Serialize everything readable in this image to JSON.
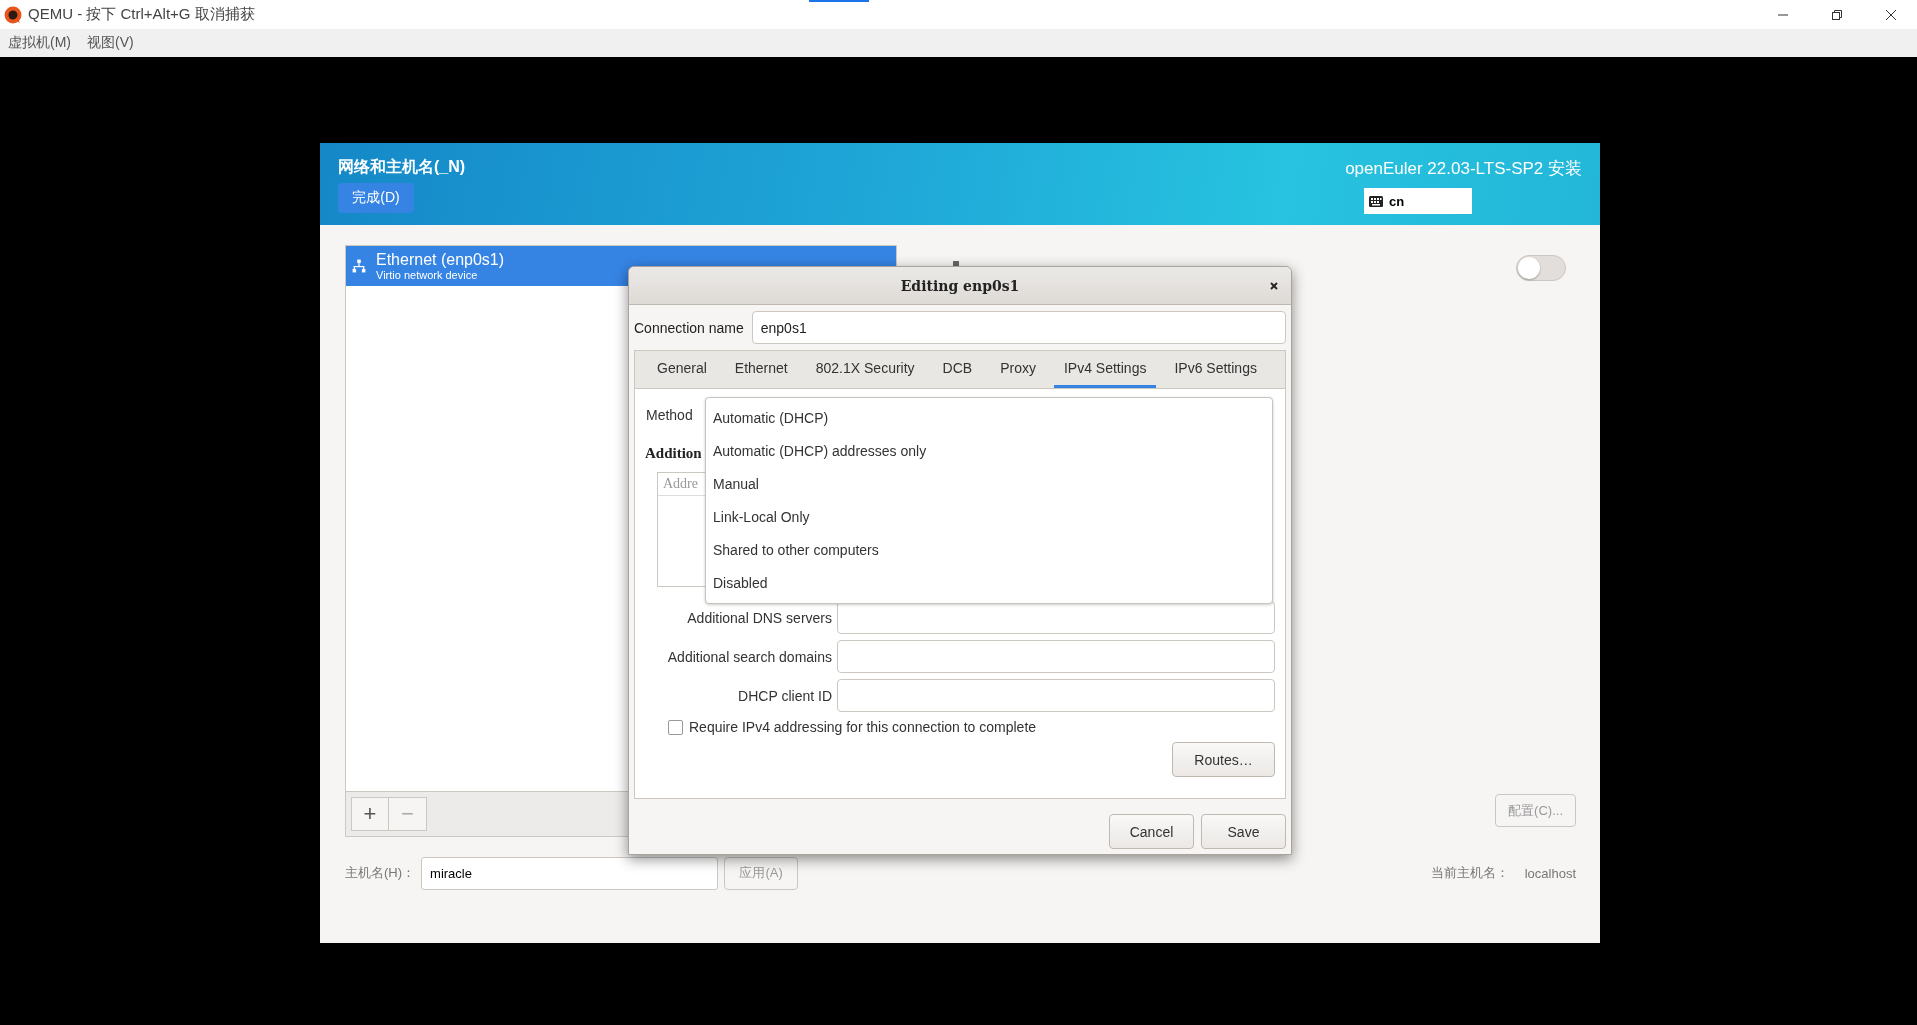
{
  "window": {
    "title": "QEMU - 按下 Ctrl+Alt+G 取消捕获"
  },
  "menu": [
    "虚拟机(M)",
    "视图(V)"
  ],
  "installer": {
    "section_title": "网络和主机名(_N)",
    "done_button": "完成(D)",
    "product": "openEuler 22.03-LTS-SP2 安装",
    "keyboard_layout": "cn"
  },
  "devices": [
    {
      "name": "Ethernet (enp0s1)",
      "description": "Virtio network device",
      "selected": true
    }
  ],
  "list_buttons": [
    "+",
    "−"
  ],
  "device_detail": {
    "on": false
  },
  "configure_button": {
    "label": "配置(C)...",
    "disabled": true
  },
  "hostname": {
    "label": "主机名(H)：",
    "value": "miracle",
    "apply_button": "应用(A)",
    "apply_disabled": true,
    "current_label": "当前主机名：",
    "current_value": "localhost"
  },
  "dialog": {
    "title": "Editing enp0s1",
    "connection_name_label": "Connection name",
    "connection_name": "enp0s1",
    "tabs": [
      {
        "label": "General",
        "selected": false
      },
      {
        "label": "Ethernet",
        "selected": false
      },
      {
        "label": "802.1X Security",
        "selected": false
      },
      {
        "label": "DCB",
        "selected": false
      },
      {
        "label": "Proxy",
        "selected": false
      },
      {
        "label": "IPv4 Settings",
        "selected": true
      },
      {
        "label": "IPv6 Settings",
        "selected": false
      }
    ],
    "method_label": "Method",
    "method_options": [
      "Automatic (DHCP)",
      "Automatic (DHCP) addresses only",
      "Manual",
      "Link-Local Only",
      "Shared to other computers",
      "Disabled"
    ],
    "addresses_heading": "Addition",
    "addresses_column": "Addre",
    "fields": [
      "Additional DNS servers",
      "Additional search domains",
      "DHCP client ID"
    ],
    "require_checkbox": {
      "label": "Require IPv4 addressing for this connection to complete",
      "checked": false
    },
    "routes_button": "Routes…",
    "buttons": [
      "Cancel",
      "Save"
    ]
  }
}
